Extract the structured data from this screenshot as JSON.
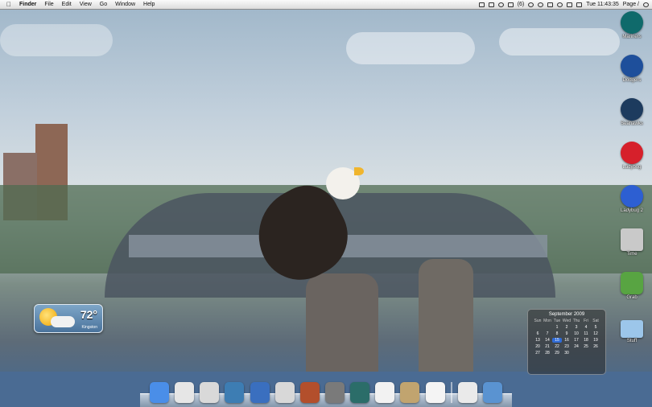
{
  "menubar": {
    "app_name": "Finder",
    "menus": [
      "File",
      "Edit",
      "View",
      "Go",
      "Window",
      "Help"
    ],
    "status_text": "Page /",
    "clock": "Tue 11:43:35",
    "battery_label": "(6)"
  },
  "desktop_icons": [
    {
      "label": "Mariners",
      "color": "#0f6a6b"
    },
    {
      "label": "Dodgers",
      "color": "#1e4f9b"
    },
    {
      "label": "Seahawks",
      "color": "#1d3b5e"
    },
    {
      "label": "Ladybug",
      "color": "#d6202b"
    },
    {
      "label": "Ladybug 2",
      "color": "#2d5fd2"
    },
    {
      "label": "Time",
      "color": "#c9c9c9"
    },
    {
      "label": "Grab",
      "color": "#58a442"
    },
    {
      "label": "Stuff",
      "color": "#9cc6ea"
    }
  ],
  "weather": {
    "temp": "72°",
    "place": "Kingston"
  },
  "calendar": {
    "title": "September 2009",
    "weekdays": [
      "Sun",
      "Mon",
      "Tue",
      "Wed",
      "Thu",
      "Fri",
      "Sat"
    ],
    "weeks": [
      [
        "",
        "",
        "1",
        "2",
        "3",
        "4",
        "5"
      ],
      [
        "6",
        "7",
        "8",
        "9",
        "10",
        "11",
        "12"
      ],
      [
        "13",
        "14",
        "15",
        "16",
        "17",
        "18",
        "19"
      ],
      [
        "20",
        "21",
        "22",
        "23",
        "24",
        "25",
        "26"
      ],
      [
        "27",
        "28",
        "29",
        "30",
        "",
        "",
        ""
      ]
    ],
    "today": "15"
  },
  "dock": [
    {
      "name": "finder",
      "color": "#4a8ee8"
    },
    {
      "name": "safari",
      "color": "#e6e6e6"
    },
    {
      "name": "mail",
      "color": "#d9d9d9"
    },
    {
      "name": "iphoto",
      "color": "#3d7db3"
    },
    {
      "name": "pencil",
      "color": "#3a6fbf"
    },
    {
      "name": "textedit",
      "color": "#d8d8d8"
    },
    {
      "name": "photo-browser",
      "color": "#b34f2c"
    },
    {
      "name": "network-utility",
      "color": "#7a7a7a"
    },
    {
      "name": "time-machine",
      "color": "#2b6d69"
    },
    {
      "name": "ical",
      "color": "#f2f2f2"
    },
    {
      "name": "utilities",
      "color": "#c1a46f"
    },
    {
      "name": "document",
      "color": "#f4f4f4"
    },
    {
      "name": "folder-stack",
      "color": "#eaeaea"
    },
    {
      "name": "trash",
      "color": "#5a93d1"
    }
  ]
}
